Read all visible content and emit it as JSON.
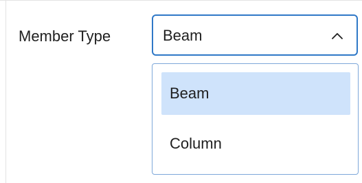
{
  "form": {
    "member_type_label": "Member Type",
    "selected_value": "Beam",
    "options": [
      {
        "label": "Beam",
        "selected": true
      },
      {
        "label": "Column",
        "selected": false
      }
    ]
  },
  "icons": {
    "dropdown_toggle": "chevron-up-icon"
  },
  "colors": {
    "focus_border": "#2f78c7",
    "selected_background": "#cfe3fb",
    "dropdown_border": "#7da7d9"
  }
}
